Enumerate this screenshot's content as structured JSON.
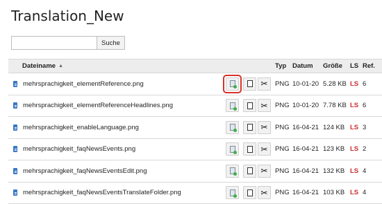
{
  "page": {
    "title": "Translation_New"
  },
  "search": {
    "placeholder": "",
    "value": "",
    "button_label": "Suche"
  },
  "table": {
    "headers": {
      "name": "Dateiname",
      "type": "Typ",
      "date": "Datum",
      "size": "Größe",
      "ls": "LS",
      "ref": "Ref."
    },
    "sort_indicator": "▲",
    "rows": [
      {
        "name": "mehrsprachigkeit_elementReference.png",
        "type": "PNG",
        "date": "10-01-20",
        "size": "5.28 KB",
        "ls": "LS",
        "ref": "6"
      },
      {
        "name": "mehrsprachigkeit_elementReferenceHeadlines.png",
        "type": "PNG",
        "date": "10-01-20",
        "size": "7.78 KB",
        "ls": "LS",
        "ref": "6"
      },
      {
        "name": "mehrsprachigkeit_enableLanguage.png",
        "type": "PNG",
        "date": "16-04-21",
        "size": "124 KB",
        "ls": "LS",
        "ref": "3"
      },
      {
        "name": "mehrsprachigkeit_faqNewsEvents.png",
        "type": "PNG",
        "date": "16-04-21",
        "size": "123 KB",
        "ls": "LS",
        "ref": "2"
      },
      {
        "name": "mehrsprachigkeit_faqNewsEventsEdit.png",
        "type": "PNG",
        "date": "16-04-21",
        "size": "132 KB",
        "ls": "LS",
        "ref": "4"
      },
      {
        "name": "mehrsprachigkeit_faqNewsEventsTranslateFolder.png",
        "type": "PNG",
        "date": "16-04-21",
        "size": "103 KB",
        "ls": "LS",
        "ref": "4"
      }
    ]
  },
  "colors": {
    "highlight": "#d9302a",
    "ls_text": "#d02c2c",
    "file_icon": "#3b78c4"
  },
  "icons": {
    "file": "file-icon",
    "image_edit": "image-icon",
    "copy": "copy-icon",
    "cut": "scissors-icon"
  }
}
